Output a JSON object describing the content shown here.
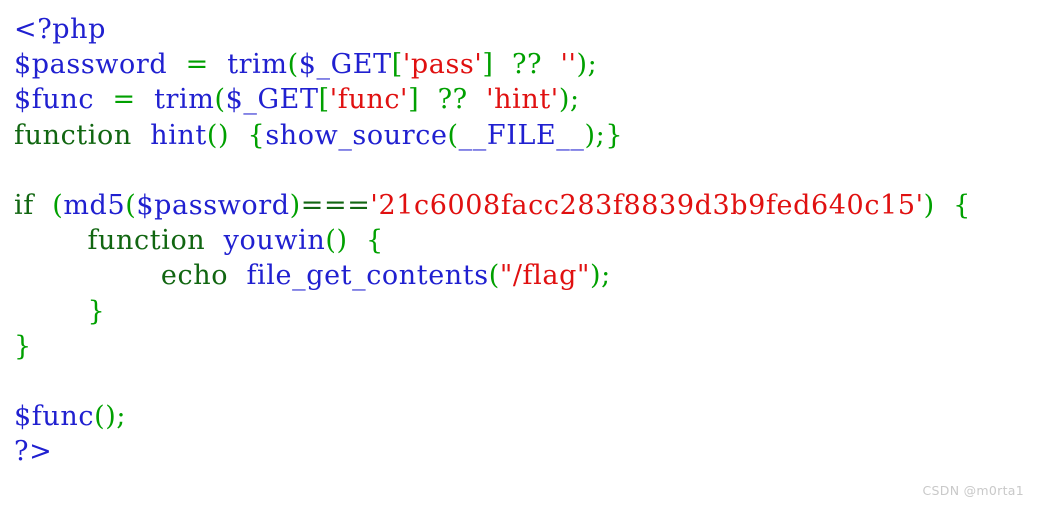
{
  "document": {
    "kind": "php-source-listing",
    "language": "PHP",
    "background_color": "#ffffff",
    "colors": {
      "variable": "#2020d0",
      "identifier": "#2020d0",
      "keyword": "#116611",
      "punctuation": "#00a000",
      "string": "#e01010",
      "tag": "#2020d0",
      "watermark": "#c9c9c9"
    },
    "md5_hash": "21c6008facc283f8839d3b9fed640c15",
    "plain_text": "<?php\n$password = trim($_GET['pass'] ?? '');\n$func = trim($_GET['func'] ?? 'hint');\nfunction hint() {show_source(__FILE__);}\n\nif (md5($password)==='21c6008facc283f8839d3b9fed640c15') {\n        function youwin() {\n                echo file_get_contents(\"/flag\");\n        }\n}\n\n$func();\n?>",
    "lines": [
      {
        "indent": "",
        "tokens": [
          {
            "t": "<?php",
            "c": "t-tag"
          }
        ]
      },
      {
        "indent": "",
        "tokens": [
          {
            "t": "$password",
            "c": "t-var"
          },
          {
            "t": "  ",
            "c": "t-punct"
          },
          {
            "t": "=",
            "c": "t-punct"
          },
          {
            "t": "  ",
            "c": "t-punct"
          },
          {
            "t": "trim",
            "c": "t-ident"
          },
          {
            "t": "(",
            "c": "t-punct"
          },
          {
            "t": "$_GET",
            "c": "t-var"
          },
          {
            "t": "[",
            "c": "t-punct"
          },
          {
            "t": "'pass'",
            "c": "t-string"
          },
          {
            "t": "]",
            "c": "t-punct"
          },
          {
            "t": "  ",
            "c": "t-punct"
          },
          {
            "t": "??",
            "c": "t-punct"
          },
          {
            "t": "  ",
            "c": "t-punct"
          },
          {
            "t": "''",
            "c": "t-string"
          },
          {
            "t": ")",
            "c": "t-punct"
          },
          {
            "t": ";",
            "c": "t-punct"
          }
        ]
      },
      {
        "indent": "",
        "tokens": [
          {
            "t": "$func",
            "c": "t-var"
          },
          {
            "t": "  ",
            "c": "t-punct"
          },
          {
            "t": "=",
            "c": "t-punct"
          },
          {
            "t": "  ",
            "c": "t-punct"
          },
          {
            "t": "trim",
            "c": "t-ident"
          },
          {
            "t": "(",
            "c": "t-punct"
          },
          {
            "t": "$_GET",
            "c": "t-var"
          },
          {
            "t": "[",
            "c": "t-punct"
          },
          {
            "t": "'func'",
            "c": "t-string"
          },
          {
            "t": "]",
            "c": "t-punct"
          },
          {
            "t": "  ",
            "c": "t-punct"
          },
          {
            "t": "??",
            "c": "t-punct"
          },
          {
            "t": "  ",
            "c": "t-punct"
          },
          {
            "t": "'hint'",
            "c": "t-string"
          },
          {
            "t": ")",
            "c": "t-punct"
          },
          {
            "t": ";",
            "c": "t-punct"
          }
        ]
      },
      {
        "indent": "",
        "tokens": [
          {
            "t": "function",
            "c": "t-keyword"
          },
          {
            "t": "  ",
            "c": "t-punct"
          },
          {
            "t": "hint",
            "c": "t-ident"
          },
          {
            "t": "()",
            "c": "t-punct"
          },
          {
            "t": "  ",
            "c": "t-punct"
          },
          {
            "t": "{",
            "c": "t-punct"
          },
          {
            "t": "show_source",
            "c": "t-ident"
          },
          {
            "t": "(",
            "c": "t-punct"
          },
          {
            "t": "__FILE__",
            "c": "t-var"
          },
          {
            "t": ")",
            "c": "t-punct"
          },
          {
            "t": ";}",
            "c": "t-punct"
          }
        ]
      },
      {
        "indent": "",
        "tokens": []
      },
      {
        "indent": "",
        "tokens": [
          {
            "t": "if",
            "c": "t-keyword"
          },
          {
            "t": "  ",
            "c": "t-punct"
          },
          {
            "t": "(",
            "c": "t-punct"
          },
          {
            "t": "md5",
            "c": "t-ident"
          },
          {
            "t": "(",
            "c": "t-punct"
          },
          {
            "t": "$password",
            "c": "t-var"
          },
          {
            "t": ")",
            "c": "t-punct"
          },
          {
            "t": "===",
            "c": "t-keyword"
          },
          {
            "t": "'21c6008facc283f8839d3b9fed640c15'",
            "c": "t-string"
          },
          {
            "t": ")",
            "c": "t-punct"
          },
          {
            "t": "  ",
            "c": "t-punct"
          },
          {
            "t": "{",
            "c": "t-punct"
          }
        ]
      },
      {
        "indent": "        ",
        "tokens": [
          {
            "t": "function",
            "c": "t-keyword"
          },
          {
            "t": "  ",
            "c": "t-punct"
          },
          {
            "t": "youwin",
            "c": "t-ident"
          },
          {
            "t": "()",
            "c": "t-punct"
          },
          {
            "t": "  ",
            "c": "t-punct"
          },
          {
            "t": "{",
            "c": "t-punct"
          }
        ]
      },
      {
        "indent": "                ",
        "tokens": [
          {
            "t": "echo",
            "c": "t-keyword"
          },
          {
            "t": "  ",
            "c": "t-punct"
          },
          {
            "t": "file_get_contents",
            "c": "t-ident"
          },
          {
            "t": "(",
            "c": "t-punct"
          },
          {
            "t": "\"/flag\"",
            "c": "t-string"
          },
          {
            "t": ")",
            "c": "t-punct"
          },
          {
            "t": ";",
            "c": "t-punct"
          }
        ]
      },
      {
        "indent": "        ",
        "tokens": [
          {
            "t": "}",
            "c": "t-punct"
          }
        ]
      },
      {
        "indent": "",
        "tokens": [
          {
            "t": "}",
            "c": "t-punct"
          }
        ]
      },
      {
        "indent": "",
        "tokens": []
      },
      {
        "indent": "",
        "tokens": [
          {
            "t": "$func",
            "c": "t-var"
          },
          {
            "t": "()",
            "c": "t-punct"
          },
          {
            "t": ";",
            "c": "t-punct"
          }
        ]
      },
      {
        "indent": "",
        "tokens": [
          {
            "t": "?>",
            "c": "t-tag"
          }
        ]
      }
    ]
  },
  "watermark": {
    "text": "CSDN @m0rta1"
  }
}
